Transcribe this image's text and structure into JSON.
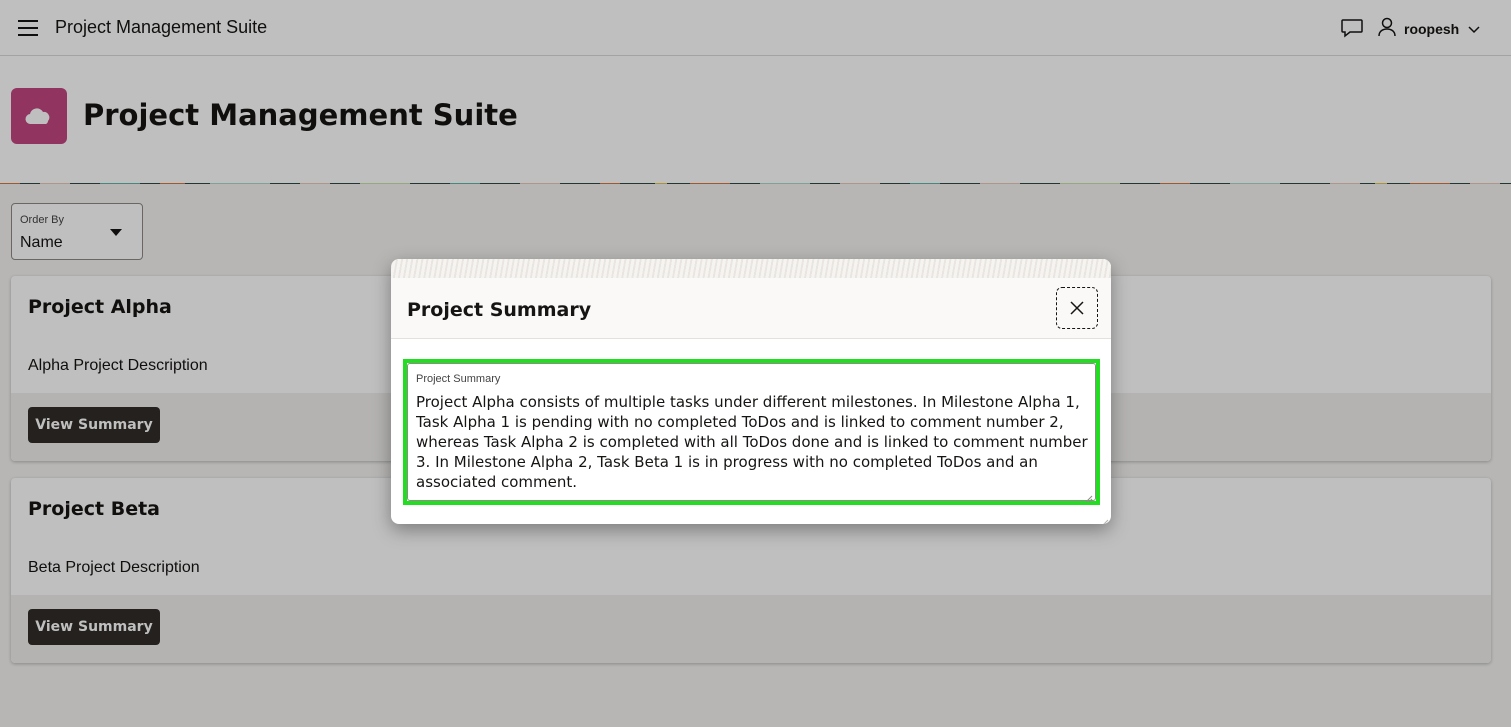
{
  "header": {
    "app_title": "Project Management Suite",
    "user_name": "roopesh"
  },
  "hero": {
    "title": "Project Management Suite",
    "logo_color": "#c24680"
  },
  "order_by": {
    "label": "Order By",
    "value": "Name"
  },
  "projects": [
    {
      "name": "Project Alpha",
      "description": "Alpha Project Description",
      "button_label": "View Summary"
    },
    {
      "name": "Project Beta",
      "description": "Beta Project Description",
      "button_label": "View Summary"
    }
  ],
  "dialog": {
    "title": "Project Summary",
    "field_label": "Project Summary",
    "field_value": "Project Alpha consists of multiple tasks under different milestones. In Milestone Alpha 1, Task Alpha 1 is pending with no completed ToDos and is linked to comment number 2, whereas Task Alpha 2 is completed with all ToDos done and is linked to comment number 3. In Milestone Alpha 2, Task Beta 1 is in progress with no completed ToDos and an associated comment.",
    "highlight_color": "#22dd22"
  },
  "icons": {
    "menu": "hamburger-menu-icon",
    "chat": "chat-bubble-icon",
    "user": "user-icon",
    "chevron": "chevron-down-icon",
    "logo": "cloud-icon",
    "close": "close-icon"
  }
}
